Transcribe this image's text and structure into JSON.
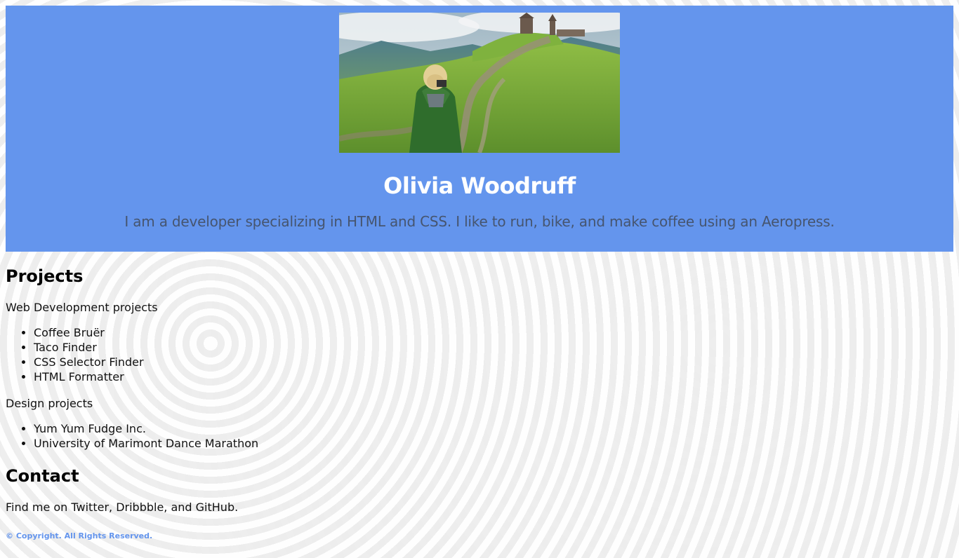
{
  "header": {
    "name": "Olivia Woodruff",
    "bio": "I am a developer specializing in HTML and CSS. I like to run, bike, and make coffee using an Aeropress.",
    "background_color": "#6495ed"
  },
  "projects": {
    "title": "Projects",
    "web_label": "Web Development projects",
    "web_items": [
      "Coffee Bruër",
      "Taco Finder",
      "CSS Selector Finder",
      "HTML Formatter"
    ],
    "design_label": "Design projects",
    "design_items": [
      "Yum Yum Fudge Inc.",
      "University of Marimont Dance Marathon"
    ]
  },
  "contact": {
    "title": "Contact",
    "text": "Find me on Twitter, Dribbble, and GitHub."
  },
  "footer": {
    "text": "© Copyright. All Rights Reserved."
  }
}
